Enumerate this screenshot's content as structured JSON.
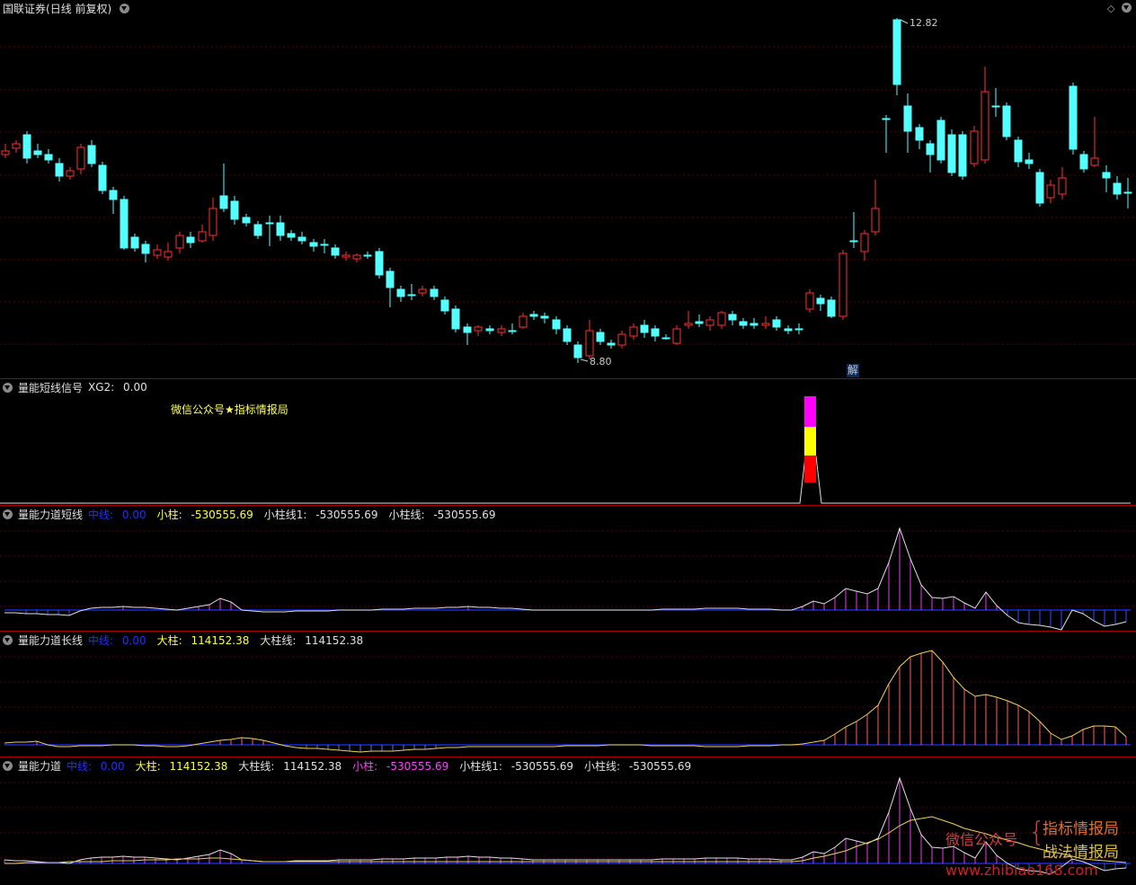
{
  "main": {
    "title": "国联证券",
    "period": "(日线 前复权)",
    "high_label": "12.82",
    "low_label": "8.80",
    "marker": "解",
    "icons": [
      "diamond-icon",
      "dropdown-circle-icon"
    ]
  },
  "panel1": {
    "name": "量能短线信号",
    "items": [
      {
        "label": "XG2:",
        "value": "0.00",
        "color": "#e0e0e0"
      }
    ],
    "annotation": "微信公众号★指标情报局"
  },
  "panel2": {
    "name": "量能力道短线",
    "items": [
      {
        "label": "中线:",
        "value": "0.00",
        "color": "#2030ff"
      },
      {
        "label": "小柱:",
        "value": "-530555.69",
        "color": "#ffff40"
      },
      {
        "label": "小柱线1:",
        "value": "-530555.69",
        "color": "#e0e0e0"
      },
      {
        "label": "小柱线:",
        "value": "-530555.69",
        "color": "#e0e0e0"
      }
    ]
  },
  "panel3": {
    "name": "量能力道长线",
    "items": [
      {
        "label": "中线:",
        "value": "0.00",
        "color": "#2030ff"
      },
      {
        "label": "大柱:",
        "value": "114152.38",
        "color": "#ffff40"
      },
      {
        "label": "大柱线:",
        "value": "114152.38",
        "color": "#e0e0e0"
      }
    ]
  },
  "panel4": {
    "name": "量能力道",
    "items": [
      {
        "label": "中线:",
        "value": "0.00",
        "color": "#2030ff"
      },
      {
        "label": "大柱:",
        "value": "114152.38",
        "color": "#ffff40"
      },
      {
        "label": "大柱线:",
        "value": "114152.38",
        "color": "#e0e0e0"
      },
      {
        "label": "小柱:",
        "value": "-530555.69",
        "color": "#ff40ff"
      },
      {
        "label": "小柱线1:",
        "value": "-530555.69",
        "color": "#e0e0e0"
      },
      {
        "label": "小柱线:",
        "value": "-530555.69",
        "color": "#e0e0e0"
      }
    ]
  },
  "watermark": {
    "prefix": "微信公众号",
    "brace": "{",
    "line1": "指标情报局",
    "line2": "战法情报局",
    "url": "www.zhibiao168.com"
  },
  "colors": {
    "up": "#ff3030",
    "down": "#54ffff",
    "separator": "#a30000",
    "midline": "#2030ff"
  }
}
